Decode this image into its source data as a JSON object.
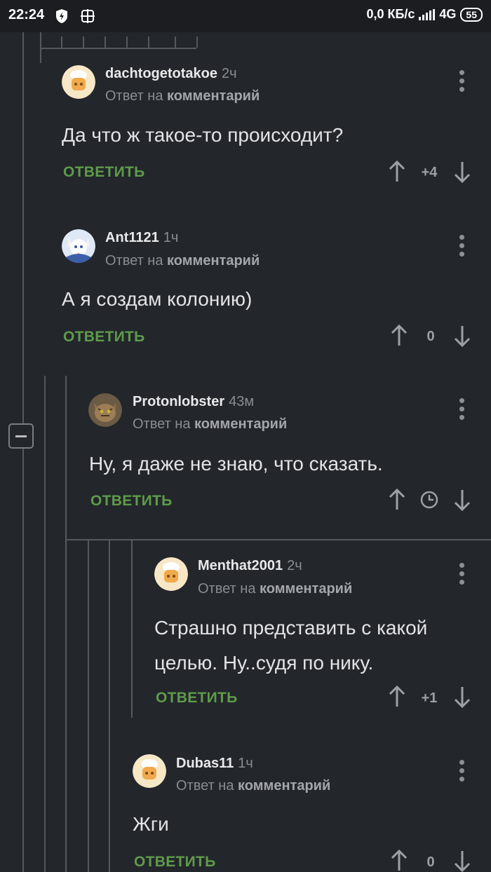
{
  "status_bar": {
    "time": "22:24",
    "network_speed": "0,0 КБ/с",
    "network_type": "4G",
    "battery": "55"
  },
  "comments": [
    {
      "username": "dachtogetotakoe",
      "time": "2ч",
      "reply_prefix": "Ответ на",
      "reply_target": "комментарий",
      "text": "Да что ж такое-то происходит?",
      "reply_label": "ОТВЕТИТЬ",
      "score": "+4",
      "avatar": "chef-avatar"
    },
    {
      "username": "Ant1121",
      "time": "1ч",
      "reply_prefix": "Ответ на",
      "reply_target": "комментарий",
      "text": "А я создам колонию)",
      "reply_label": "ОТВЕТИТЬ",
      "score": "0",
      "avatar": "anime-dog-avatar"
    },
    {
      "username": "Protonlobster",
      "time": "43м",
      "reply_prefix": "Ответ на",
      "reply_target": "комментарий",
      "text": "Ну, я даже не знаю, что сказать.",
      "reply_label": "ОТВЕТИТЬ",
      "score_icon": "clock-icon",
      "avatar": "cat-avatar"
    },
    {
      "username": "Menthat2001",
      "time": "2ч",
      "reply_prefix": "Ответ на",
      "reply_target": "комментарий",
      "text_line1": "Страшно представить с какой",
      "text_line2": "целью. Ну..судя по нику.",
      "reply_label": "ОТВЕТИТЬ",
      "score": "+1",
      "avatar": "chef-avatar"
    },
    {
      "username": "Dubas11",
      "time": "1ч",
      "reply_prefix": "Ответ на",
      "reply_target": "комментарий",
      "text": "Жги",
      "reply_label": "ОТВЕТИТЬ",
      "score": "0",
      "avatar": "chef-avatar"
    }
  ],
  "colors": {
    "background": "#23262b",
    "reply_green": "#5e9b4a",
    "thread_line": "#55585e"
  }
}
